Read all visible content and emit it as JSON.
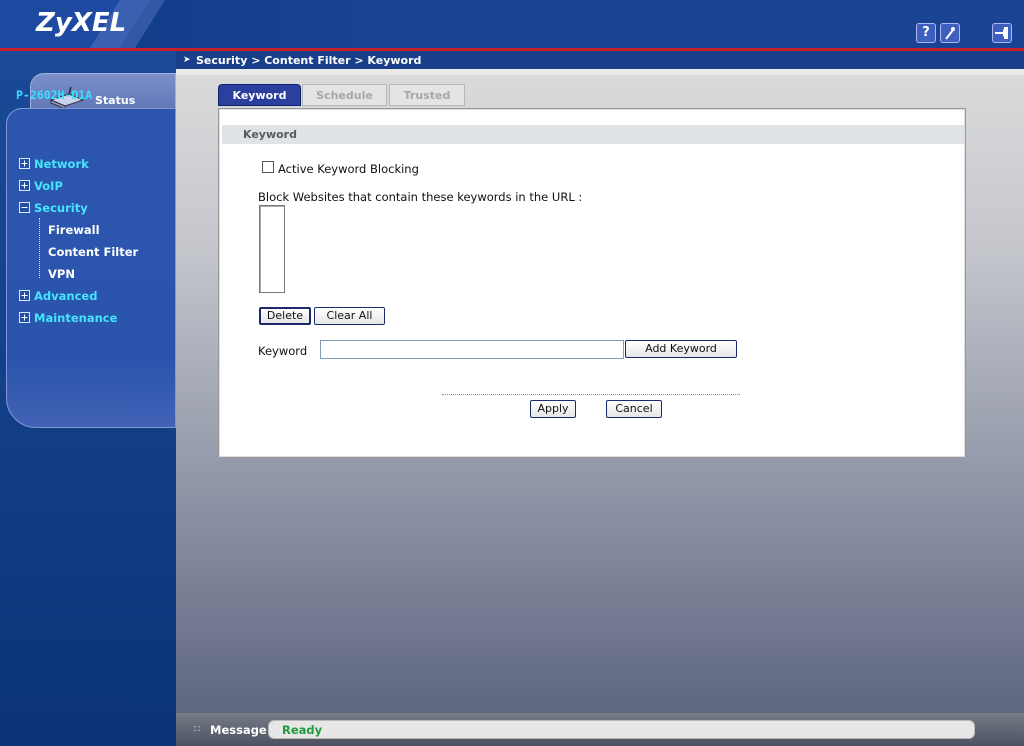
{
  "brand": {
    "logo": "ZyXEL"
  },
  "header": {
    "help_icon": "?",
    "wizard_icon": "wizard-icon",
    "logout_icon": "logout-icon"
  },
  "sidebar": {
    "status_label": "Status",
    "model": "P-2602H-D1A",
    "menu": [
      {
        "label": "Network",
        "expanded": false
      },
      {
        "label": "VoIP",
        "expanded": false
      },
      {
        "label": "Security",
        "expanded": true,
        "children": [
          "Firewall",
          "Content Filter",
          "VPN"
        ]
      },
      {
        "label": "Advanced",
        "expanded": false
      },
      {
        "label": "Maintenance",
        "expanded": false
      }
    ]
  },
  "breadcrumb": "Security > Content Filter > Keyword",
  "tabs": [
    {
      "label": "Keyword",
      "active": true
    },
    {
      "label": "Schedule",
      "active": false
    },
    {
      "label": "Trusted",
      "active": false
    }
  ],
  "form": {
    "section_title": "Keyword",
    "active_blocking_label": "Active Keyword Blocking",
    "active_blocking_checked": false,
    "block_websites_label": "Block Websites that contain these keywords in the URL :",
    "delete_button": "Delete",
    "clear_all_button": "Clear All",
    "keyword_label": "Keyword",
    "keyword_value": "",
    "add_keyword_button": "Add Keyword",
    "apply_button": "Apply",
    "cancel_button": "Cancel"
  },
  "footer": {
    "message_label": "Message",
    "status": "Ready"
  },
  "colors": {
    "header_blue": "#1a4496",
    "accent_red": "#c8202a",
    "menu_cyan": "#45e5ff",
    "active_tab": "#2a3f9e",
    "ready_green": "#1d9b3e"
  }
}
